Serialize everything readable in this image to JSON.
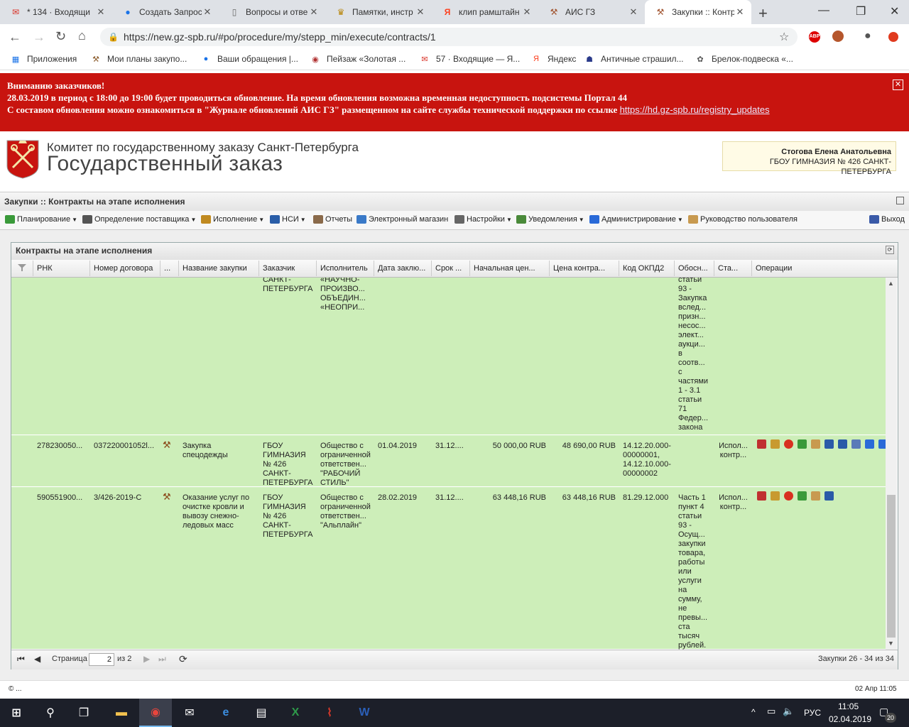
{
  "browser": {
    "tabs": [
      {
        "title": "* 134 · Входящи",
        "icon": "mail-icon",
        "icon_color": "#d93025"
      },
      {
        "title": "Создать Запрос",
        "icon": "globe-icon",
        "icon_color": "#1a73e8"
      },
      {
        "title": "Вопросы и отве",
        "icon": "page-icon",
        "icon_color": "#666666"
      },
      {
        "title": "Памятки, инстр",
        "icon": "emblem-icon",
        "icon_color": "#b8860b"
      },
      {
        "title": "клип рамштайн",
        "icon": "yandex-icon",
        "icon_color": "#fc3f1d"
      },
      {
        "title": "АИС ГЗ",
        "icon": "gavel-icon",
        "icon_color": "#a0522d"
      },
      {
        "title": "Закупки :: Контр",
        "icon": "gavel-icon",
        "icon_color": "#a0522d"
      }
    ],
    "active_tab": 6,
    "url": "https://new.gz-spb.ru/#po/procedure/my/stepp_min/execute/contracts/1",
    "bookmarks": [
      {
        "label": "Приложения",
        "icon": "apps-icon"
      },
      {
        "label": "Мои планы закупо...",
        "icon": "gavel-icon"
      },
      {
        "label": "Ваши обращения |...",
        "icon": "globe-icon"
      },
      {
        "label": "Пейзаж «Золотая ...",
        "icon": "image-icon"
      },
      {
        "label": "57 · Входящие — Я...",
        "icon": "mail-icon"
      },
      {
        "label": "Яндекс",
        "icon": "yandex-icon"
      },
      {
        "label": "Античные страшил...",
        "icon": "person-icon"
      },
      {
        "label": "Брелок-подвеска «...",
        "icon": "paw-icon"
      }
    ],
    "extensions": [
      "ABP"
    ]
  },
  "alert": {
    "line1": "Вниманию заказчиков!",
    "line2": "28.03.2019 в период с 18:00 до 19:00 будет проводиться обновление. На время обновления возможна временная недоступность подсистемы Портал 44",
    "line3": "С составом обновления можно ознакомиться в \"Журнале обновлений АИС ГЗ\" размещенном на сайте службы технической поддержки по ссылке",
    "link": "https://hd.gz-spb.ru/registry_updates",
    "close": "✕"
  },
  "header": {
    "org": "Комитет по государственному заказу Санкт-Петербурга",
    "title": "Государственный заказ",
    "user_name": "Стогова Елена Анатольевна",
    "user_org": "ГБОУ ГИМНАЗИЯ № 426 САНКТ-ПЕТЕРБУРГА"
  },
  "page_title": "Закупки :: Контракты на этапе исполнения",
  "menu": [
    {
      "label": "Планирование",
      "dropdown": true,
      "icon_color": "#3a9a3a"
    },
    {
      "label": "Определение поставщика",
      "dropdown": true,
      "icon_color": "#555555"
    },
    {
      "label": "Исполнение",
      "dropdown": true,
      "icon_color": "#c08a20"
    },
    {
      "label": "НСИ",
      "dropdown": true,
      "icon_color": "#2a5ea8"
    },
    {
      "label": "Отчеты",
      "dropdown": false,
      "icon_color": "#8a6a4a"
    },
    {
      "label": "Электронный магазин",
      "dropdown": false,
      "icon_color": "#3a7ac8"
    },
    {
      "label": "Настройки",
      "dropdown": true,
      "icon_color": "#666666"
    },
    {
      "label": "Уведомления",
      "dropdown": true,
      "icon_color": "#4a8a3a"
    },
    {
      "label": "Администрирование",
      "dropdown": true,
      "icon_color": "#2a6ad8"
    },
    {
      "label": "Руководство пользователя",
      "dropdown": false,
      "icon_color": "#c89a50"
    }
  ],
  "logout": "Выход",
  "grid": {
    "title": "Контракты на этапе исполнения",
    "columns": [
      "РНК",
      "Номер договора",
      "...",
      "Название закупки",
      "Заказчик",
      "Исполнитель",
      "Дата заклю...",
      "Срок ...",
      "Начальная цен...",
      "Цена контра...",
      "Код ОКПД2",
      "Обосн...",
      "Ста...",
      "Операции"
    ],
    "rows": [
      {
        "rnk": "",
        "number": "",
        "name": "",
        "customer": "САНКТ-\nПЕТЕРБУРГА",
        "supplier": "«НАУЧНО-\nПРОИЗВО...\nОБЪЕДИН...\n«НЕОПРИ...",
        "date": "",
        "term": "",
        "initial_price": "",
        "price": "",
        "okpd": "",
        "reason": "статьи\n93 -\nЗакупка\nвслед...\nпризн...\nнесос...\nэлект...\nаукци...\nв\nсоотв...\nс\nчастями\n1 - 3.1\nстатьи\n71\nФедер...\nзакона",
        "status": "",
        "ops_count": 0
      },
      {
        "rnk": "278230050...",
        "number": "037220001052l...",
        "name": "Закупка\nспецодежды",
        "customer": "ГБОУ\nГИМНАЗИЯ\n№ 426\nСАНКТ-\nПЕТЕРБУРГА",
        "supplier": "Общество с\nограниченной\nответствен...\n\"РАБОЧИЙ\nСТИЛЬ\"",
        "date": "01.04.2019",
        "term": "31.12....",
        "initial_price": "50 000,00 RUB",
        "price": "48 690,00 RUB",
        "okpd": "14.12.20.000-\n00000001,\n14.12.10.000-\n00000002",
        "reason": "",
        "status": "Испол...\nконтр...",
        "ops_count": 10
      },
      {
        "rnk": "590551900...",
        "number": "3/426-2019-С",
        "name": "Оказание услуг по\nочистке кровли и\nвывозу снежно-\nледовых масс",
        "customer": "ГБОУ\nГИМНАЗИЯ\n№ 426\nСАНКТ-\nПЕТЕРБУРГА",
        "supplier": "Общество с\nограниченной\nответствен...\n\"Альплайн\"",
        "date": "28.02.2019",
        "term": "31.12....",
        "initial_price": "63 448,16 RUB",
        "price": "63 448,16 RUB",
        "okpd": "81.29.12.000",
        "reason": "Часть 1\nпункт 4\nстатьи\n93 -\nОсущ...\nзакупки\nтовара,\nработы\nили\nуслуги\nна\nсумму,\nне\nпревы...\nста\nтысяч\nрублей.",
        "status": "Испол...\nконтр...",
        "ops_count": 6
      }
    ],
    "row_color": "#cdeeb9"
  },
  "pager": {
    "page_label": "Страница",
    "page_value": "2",
    "of_label": "из 2",
    "summary": "Закупки 26 - 34 из 34"
  },
  "footer": {
    "left": "© ...",
    "right": "02 Апр 11:05"
  },
  "taskbar": {
    "apps": [
      "start-icon",
      "search-icon",
      "task-view-icon",
      "explorer-icon",
      "chrome-icon",
      "mail-icon",
      "edge-icon",
      "scanner-icon",
      "excel-icon",
      "pdf-icon",
      "word-icon"
    ],
    "lang": "РУС",
    "time": "11:05",
    "date": "02.04.2019",
    "notifications": "20"
  },
  "colors": {
    "alert_bg": "#c8140f",
    "row_bg": "#cdeeb9",
    "taskbar_bg": "#1c1f29"
  }
}
